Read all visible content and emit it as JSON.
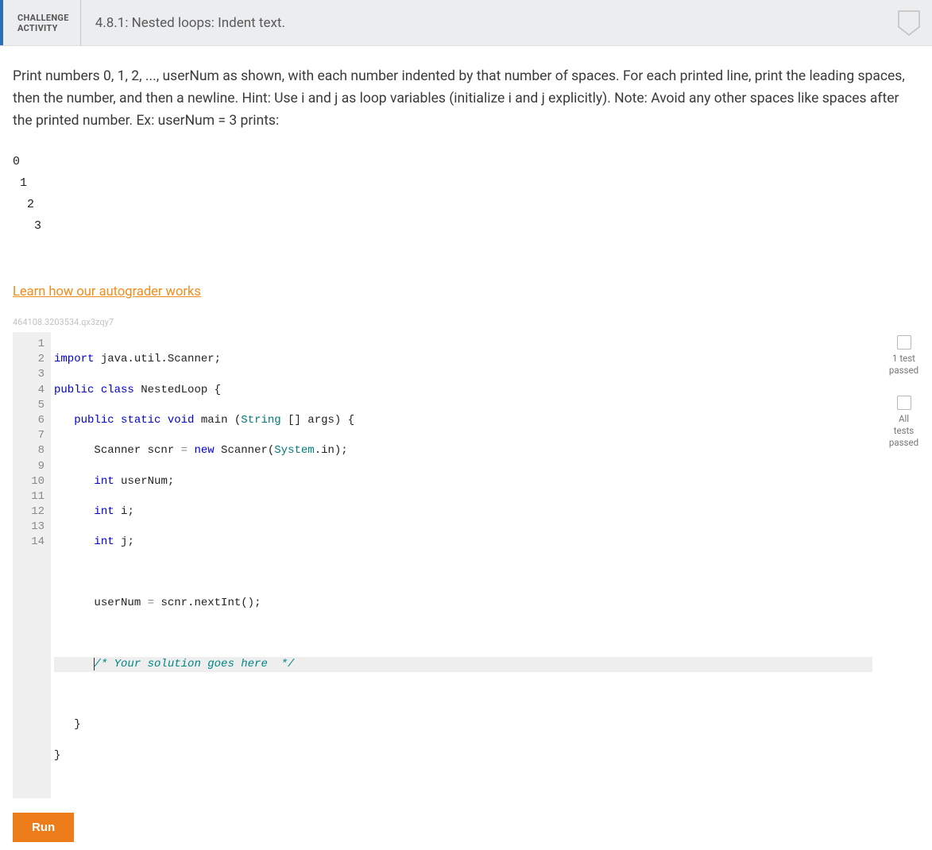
{
  "header": {
    "badge_line1": "CHALLENGE",
    "badge_line2": "ACTIVITY",
    "title": "4.8.1: Nested loops: Indent text."
  },
  "prompt": "Print numbers 0, 1, 2, ..., userNum as shown, with each number indented by that number of spaces. For each printed line, print the leading spaces, then the number, and then a newline. Hint: Use i and j as loop variables (initialize i and j explicitly). Note: Avoid any other spaces like spaces after the printed number. Ex: userNum = 3 prints:",
  "example_output": "0\n 1\n  2\n   3",
  "autograder_link": "Learn how our autograder works",
  "watermark": "464108.3203534.qx3zqy7",
  "line_numbers": [
    "1",
    "2",
    "3",
    "4",
    "5",
    "6",
    "7",
    "8",
    "9",
    "10",
    "11",
    "12",
    "13",
    "14"
  ],
  "code": {
    "l1_import": "import",
    "l1_rest": " java.util.Scanner;",
    "l2_pub": "public",
    "l2_cls": " class",
    "l2_name": " NestedLoop {",
    "l3_indent": "   ",
    "l3_pub": "public",
    "l3_static": " static",
    "l3_void": " void",
    "l3_main": " main (",
    "l3_string": "String",
    "l3_rest": " [] args) {",
    "l4_indent": "      ",
    "l4_text1": "Scanner scnr ",
    "l4_eq": "=",
    "l4_new": " new",
    "l4_text2": " Scanner(",
    "l4_system": "System",
    "l4_in": ".in);",
    "l5_indent": "      ",
    "l5_int": "int",
    "l5_rest": " userNum;",
    "l6_indent": "      ",
    "l6_int": "int",
    "l6_rest": " i;",
    "l7_indent": "      ",
    "l7_int": "int",
    "l7_rest": " j;",
    "l8": "",
    "l9_indent": "      ",
    "l9_text1": "userNum ",
    "l9_eq": "=",
    "l9_text2": " scnr.nextInt();",
    "l10": "",
    "l11_indent": "      ",
    "l11_cmt": "/* Your solution goes here  */",
    "l12": "",
    "l13": "   }",
    "l14": "}"
  },
  "status": {
    "one_test": "1 test\npassed",
    "all_tests": "All tests\npassed"
  },
  "run_label": "Run"
}
